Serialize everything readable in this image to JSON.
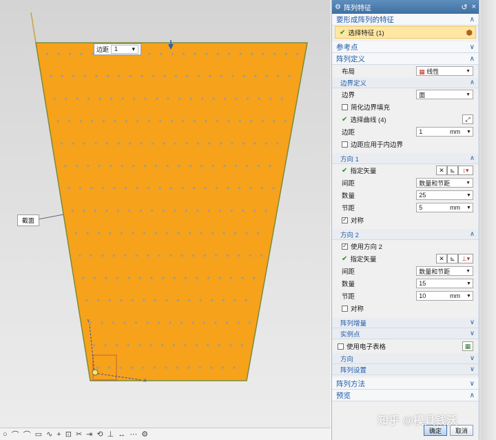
{
  "viewport": {
    "margin_field": {
      "label": "边距",
      "value": "1"
    },
    "section_tag": "截面",
    "axis_x": "X",
    "axis_y": "Y"
  },
  "dialog": {
    "title": "阵列特征",
    "title_controls": {
      "reset": "↺",
      "close": "×"
    },
    "features_section": {
      "title": "要形成阵列的特征",
      "select_label": "选择特征 (1)"
    },
    "reference_point": {
      "title": "参考点"
    },
    "array_definition": {
      "title": "阵列定义",
      "layout_label": "布局",
      "layout_value": "线性",
      "boundary": {
        "title": "边界定义",
        "boundary_label": "边界",
        "boundary_value": "面",
        "simplify_fill": "简化边界填充",
        "select_curve": "选择曲线 (4)",
        "margin_label": "边距",
        "margin_value": "1",
        "margin_unit": "mm",
        "apply_inner": "边距应用于内边界"
      },
      "direction1": {
        "title": "方向 1",
        "vector_label": "指定矢量",
        "spacing_label": "间距",
        "spacing_value": "数量和节距",
        "count_label": "数量",
        "count_value": "25",
        "pitch_label": "节距",
        "pitch_value": "5",
        "pitch_unit": "mm",
        "symmetric": "对称"
      },
      "direction2": {
        "title": "方向 2",
        "use_dir2": "使用方向 2",
        "vector_label": "指定矢量",
        "spacing_label": "间距",
        "spacing_value": "数量和节距",
        "count_label": "数量",
        "count_value": "15",
        "pitch_label": "节距",
        "pitch_value": "10",
        "pitch_unit": "mm",
        "symmetric": "对称"
      },
      "array_increment": "阵列增量",
      "instance_point": "实例点",
      "use_spreadsheet": "使用电子表格",
      "orientation": "方向",
      "array_settings": "阵列设置"
    },
    "array_method": {
      "title": "阵列方法"
    },
    "preview": {
      "title": "预览"
    },
    "buttons": {
      "ok": "确定",
      "cancel": "取消"
    }
  },
  "watermark": "知乎 @模具钱沃",
  "colors": {
    "part_fill": "#f7a21b",
    "part_edge": "#7a8a3a",
    "dot": "#a6a085",
    "title_bar": "#4a7aac",
    "accent_text": "#1f5aa8"
  }
}
